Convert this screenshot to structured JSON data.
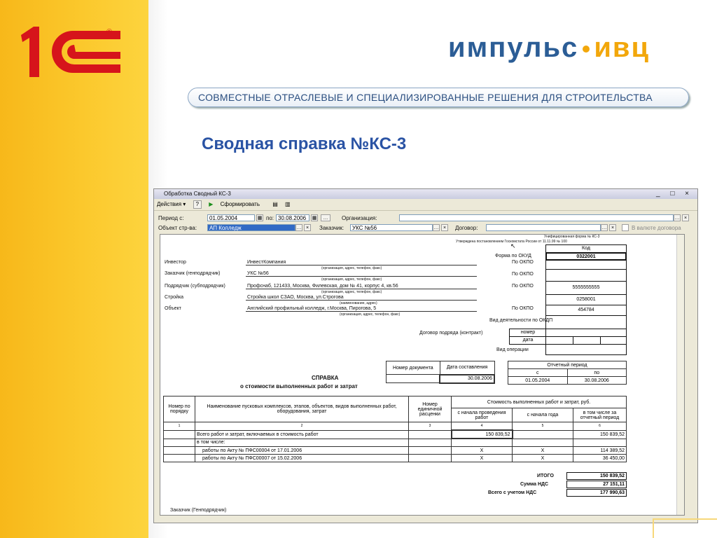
{
  "brand": {
    "logo_text": "1С",
    "company": "импульс",
    "company_suffix": "ивц",
    "slogan": "СОВМЕСТНЫЕ ОТРАСЛЕВЫЕ И СПЕЦИАЛИЗИРОВАННЫЕ РЕШЕНИЯ ДЛЯ СТРОИТЕЛЬСТВА",
    "slide_title": "Сводная справка №КС-3"
  },
  "window": {
    "title": "Обработка Сводный КС-3",
    "controls": "_ □ ×"
  },
  "toolbar": {
    "actions": "Действия ▾",
    "help": "?",
    "generate": "Сформировать"
  },
  "filters": {
    "period_from_label": "Период с:",
    "period_from": "01.05.2004",
    "period_to_label": "по:",
    "period_to": "30.08.2006",
    "org_label": "Организация:",
    "org_value": "",
    "object_label": "Объект стр-ва:",
    "object_value": "АП Колледж",
    "customer_label": "Заказчик:",
    "customer_value": "УКС №56",
    "contract_label": "Договор:",
    "contract_value": "",
    "currency_label": "В валюте договора"
  },
  "doc": {
    "form_note1": "Унифицированная форма № КС-3",
    "form_note2": "Утверждена постановлением Госкомстата России от 11.11.99 № 100",
    "code_header": "Код",
    "okud_label": "Форма по ОКУД",
    "okud": "0322001",
    "okpo_label": "По ОКПО",
    "investor_label": "Инвестор",
    "investor": "ИнвестКомпания",
    "customer_label": "Заказчик (генподрядчик)",
    "customer": "УКС №56",
    "contractor_label": "Подрядчик (субподрядчик)",
    "contractor": "Профснаб, 121433, Москва, Филевская, дом № 41, корпус 4, кв.56",
    "contractor_okpo": "5555555555",
    "site_label": "Стройка",
    "site": "Стройка школ СЗАО, Москва, ул.Строгова",
    "site_code": "0258001",
    "object_label": "Объект",
    "object": "Английский профильный колледж, г.Москва, Пирогова, 5",
    "object_okpo": "454784",
    "org_hint": "(организация, адрес, телефон, факс)",
    "name_hint": "(наименование, адрес)",
    "okdp_label": "Вид деятельности по ОКДП",
    "contract_label": "Договор подряда (контракт)",
    "contract_number": "номер",
    "contract_date": "дата",
    "operation_label": "Вид операции",
    "doc_num_header": "Номер документа",
    "doc_date_header": "Дата составления",
    "doc_date": "30.08.2006",
    "period_header": "Отчетный период",
    "period_from_header": "с",
    "period_to_header": "по",
    "period_from": "01.05.2004",
    "period_to": "30.08.2006",
    "heading": "СПРАВКА",
    "subheading": "о стоимости выполненных работ и затрат",
    "col1": "Номер по порядку",
    "col2": "Наименование пусковых комплексов, этапов, объектов, видов выполненных работ, оборудования, затрат",
    "col3": "Номер единичной расценки",
    "col_group": "Стоимость выполненных работ и затрат, руб.",
    "col4": "с начала проведения работ",
    "col5": "с начала года",
    "col6": "в том числе за отчетный период",
    "num1": "1",
    "num2": "2",
    "num3": "3",
    "num4": "4",
    "num5": "5",
    "num6": "6",
    "rows": [
      {
        "name": "Всего работ и затрат, включаемых в стоимость работ",
        "from_start": "150 839,52",
        "from_year": "",
        "period": "150 839,52"
      },
      {
        "name": "в том числе:",
        "from_start": "",
        "from_year": "",
        "period": ""
      },
      {
        "name": "работы по Акту № ПФС00004 от 17.01.2006",
        "from_start": "X",
        "from_year": "X",
        "period": "114 389,52"
      },
      {
        "name": "работы по Акту № ПФС00007 от 15.02.2006",
        "from_start": "X",
        "from_year": "X",
        "period": "36 450,00"
      }
    ],
    "total_label": "ИТОГО",
    "total": "150 839,52",
    "vat_label": "Сумма НДС",
    "vat": "27 151,11",
    "total_vat_label": "Всего с учетом НДС",
    "total_vat": "177 990,63",
    "footer_label": "Заказчик (Генподрядчик)"
  },
  "colors": {
    "yellow": "#fbc82c",
    "blue_title": "#2a53a4",
    "red_logo": "#d6141b"
  }
}
